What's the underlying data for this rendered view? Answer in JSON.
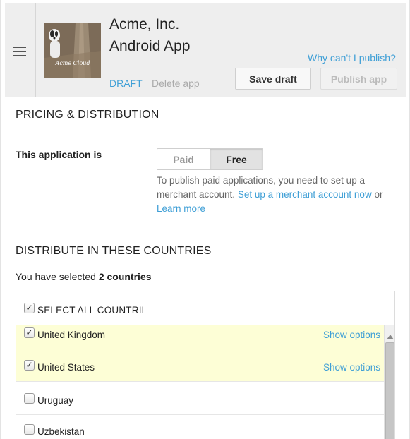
{
  "header": {
    "app_title": "Acme, Inc.\nAndroid App",
    "thumb_caption": "Acme Cloud",
    "status": "DRAFT",
    "delete_label": "Delete app",
    "why_link": "Why can't I publish?",
    "save_label": "Save draft",
    "publish_label": "Publish app"
  },
  "pricing": {
    "title": "PRICING & DISTRIBUTION",
    "app_is_label": "This application is",
    "options": [
      "Paid",
      "Free"
    ],
    "selected": "Free",
    "help_text_1": "To publish paid applications, you need to set up a merchant account.",
    "help_link_1": "Set up a merchant account now",
    "help_or": "or",
    "help_link_2": "Learn more"
  },
  "distribution": {
    "title": "DISTRIBUTE IN THESE COUNTRIES",
    "selected_prefix": "You have selected",
    "selected_count": "2 countries",
    "select_all_label": "SELECT ALL COUNTRIES",
    "show_options_label": "Show options",
    "countries": [
      {
        "name": "United Kingdom",
        "checked": true
      },
      {
        "name": "United States",
        "checked": true
      },
      {
        "name": "Uruguay",
        "checked": false
      },
      {
        "name": "Uzbekistan",
        "checked": false
      }
    ]
  },
  "colors": {
    "accent": "#3f9fd6",
    "selected_row": "#fdfed6",
    "header_bg": "#eeeeee"
  }
}
